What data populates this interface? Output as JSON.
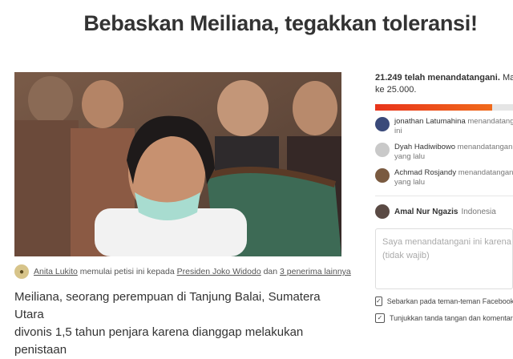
{
  "petition": {
    "title": "Bebaskan Meiliana, tegakkan toleransi!",
    "byline": {
      "starter": "Anita Lukito",
      "text_mid": " memulai petisi ini kepada ",
      "target": "Presiden Joko Widodo",
      "text_and": " dan ",
      "others": "3 penerima lainnya"
    },
    "body_line1": "Meiliana, seorang perempuan di Tanjung Balai, Sumatera Utara",
    "body_line2": "divonis 1,5 tahun penjara karena dianggap melakukan penistaan"
  },
  "signatures": {
    "count_bold": "21.249 telah menandatangani.",
    "count_rest": " Ma",
    "goal_line": "ke 25.000.",
    "progress": 0.85,
    "progress_color": "#e8341b"
  },
  "recent_signers": [
    {
      "name": "jonathan Latumahina",
      "action": " menandatangan",
      "time": "ini",
      "avatar_color": "#3a4a7a"
    },
    {
      "name": "Dyah Hadiwibowo",
      "action": " menandatangan",
      "time": "yang lalu",
      "avatar_color": "#c9c9c9"
    },
    {
      "name": "Achmad Rosjandy",
      "action": " menandatangan",
      "time": "yang lalu",
      "avatar_color": "#7a5a40"
    }
  ],
  "current_user": {
    "name": "Amal Nur Ngazis",
    "location": "Indonesia"
  },
  "comment": {
    "placeholder_line1": "Saya menandatangani ini karena",
    "placeholder_line2": "(tidak wajib)"
  },
  "options": [
    {
      "label": "Sebarkan pada teman-teman Facebook",
      "checked": true
    },
    {
      "label": "Tunjukkan tanda tangan dan komentar",
      "checked": true
    }
  ]
}
